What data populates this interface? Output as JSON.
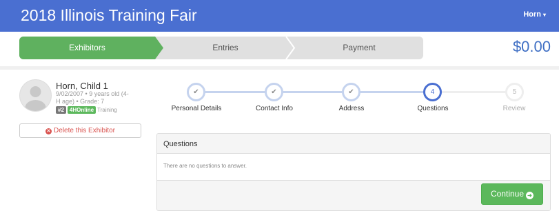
{
  "header": {
    "title": "2018 Illinois Training Fair",
    "user": "Horn"
  },
  "tabs": [
    "Exhibitors",
    "Entries",
    "Payment"
  ],
  "total": "$0.00",
  "exhibitor": {
    "name": "Horn, Child 1",
    "meta": "9/02/2007 • 9 years old (4-H age) • Grade: 7",
    "number": "#2",
    "source": "4HOnline",
    "type": "Training",
    "delete_label": "Delete this Exhibitor"
  },
  "wizard": {
    "steps": [
      {
        "label": "Personal Details",
        "state": "done"
      },
      {
        "label": "Contact Info",
        "state": "done"
      },
      {
        "label": "Address",
        "state": "done"
      },
      {
        "label": "Questions",
        "state": "current",
        "num": "4"
      },
      {
        "label": "Review",
        "state": "todo",
        "num": "5"
      }
    ]
  },
  "panel": {
    "title": "Questions",
    "message": "There are no questions to answer.",
    "continue_label": "Continue"
  },
  "colors": {
    "brand": "#4a6fd1",
    "success": "#5cb85c",
    "danger": "#d9534f"
  }
}
